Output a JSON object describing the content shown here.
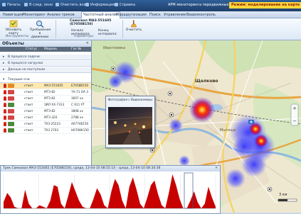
{
  "window": {
    "title": "АРМ мониторинга передвижных объектов",
    "mode_badge": "Режим: моделирование на карте"
  },
  "top_menu": [
    {
      "label": "Печать",
      "icon": "print-icon"
    },
    {
      "label": "В след. окно",
      "icon": "window-icon"
    },
    {
      "label": "Очистить все",
      "icon": "clear-icon"
    },
    {
      "label": "Информация",
      "icon": "info-icon"
    },
    {
      "label": "Справка",
      "icon": "help-icon"
    }
  ],
  "ribbon": {
    "tabs": [
      "Навигация",
      "Мониторинг",
      "Анализ треков",
      "Частотный анализ",
      "Маршрутизация",
      "Поиск",
      "Управление",
      "Видеоконтроль"
    ],
    "active_tab": "Частотный анализ",
    "buttons": {
      "refresh": "Обновить карту",
      "analysis": "Пребывание в движении",
      "vehicle": "Самосвал МАЗ-551605 (E7058B150)",
      "start_label": "Начало интервала:",
      "end_label": "Конец интервала:",
      "clear": "Очистить"
    },
    "groups": [
      "Инструменты",
      "Параметры"
    ]
  },
  "objects_panel": {
    "title": "Объекты",
    "columns": [
      "Статус",
      "Модель",
      "Гос №"
    ],
    "groups": [
      "В процессе задачи",
      "В процессе загрузки",
      "Данные не поступали"
    ],
    "subgroup": "Текущие очи",
    "rows": [
      {
        "status": "стоит",
        "model": "МАЗ-551605",
        "number": "E7058B150"
      },
      {
        "status": "стоит",
        "model": "МТЗ-82",
        "number": "7А-71 ОА 3"
      },
      {
        "status": "стоит",
        "model": "МТЗ-82",
        "number": "3607 хх"
      },
      {
        "status": "стоит",
        "model": "ЗИЛ ХХ-7313",
        "number": "С 911 УТ"
      },
      {
        "status": "стоит",
        "model": "МТЗ-82",
        "number": "3808 хх"
      },
      {
        "status": "стоит",
        "model": "МТЗ-320",
        "number": "2788 хх"
      },
      {
        "status": "стоит",
        "model": "ТХ3-25223",
        "number": "А67748150"
      },
      {
        "status": "стоит",
        "model": "ТХ3 2703",
        "number": "Н0708К150"
      }
    ]
  },
  "photo_popup": {
    "caption": "Фотография с Видеокамеры"
  },
  "map": {
    "labels": [
      "Ивантеевка",
      "Щелково",
      "Мытищи"
    ]
  },
  "chart_panel": {
    "title": "Трек Самосвал МАЗ-551605 (E7058B150), среда, 13-04-10 08:55:14 - среда, 13-04-10 08:34:36"
  },
  "chart_data": {
    "type": "area",
    "title": "Трек Самосвал МАЗ-551605 (E7058B150), среда, 13-04-10 08:55:14 - среда, 13-04-10 08:34:36",
    "xlabel": "",
    "ylabel": "",
    "x": [
      0,
      1,
      2,
      3,
      4,
      5,
      6,
      7,
      8,
      9,
      10,
      11,
      12,
      13,
      14,
      15,
      16,
      17,
      18,
      19,
      20,
      21,
      22,
      23,
      24,
      25,
      26,
      27,
      28,
      29,
      30,
      31,
      32,
      33,
      34,
      35,
      36,
      37,
      38,
      39,
      40,
      41,
      42,
      43,
      44,
      45,
      46,
      47,
      48,
      49,
      50,
      51,
      52,
      53,
      54,
      55,
      56,
      57,
      58,
      59
    ],
    "values": [
      8,
      20,
      14,
      2,
      0,
      0,
      24,
      6,
      0,
      0,
      4,
      2,
      0,
      10,
      30,
      28,
      6,
      0,
      16,
      34,
      22,
      10,
      2,
      0,
      0,
      12,
      26,
      18,
      4,
      0,
      22,
      38,
      30,
      10,
      0,
      28,
      40,
      24,
      6,
      0,
      14,
      30,
      36,
      18,
      4,
      0,
      20,
      44,
      30,
      12,
      0,
      0,
      10,
      22,
      8,
      0,
      6,
      28,
      14,
      2
    ],
    "series_color": "#c80000",
    "grid": true
  },
  "status": {
    "scale": "3 км"
  }
}
